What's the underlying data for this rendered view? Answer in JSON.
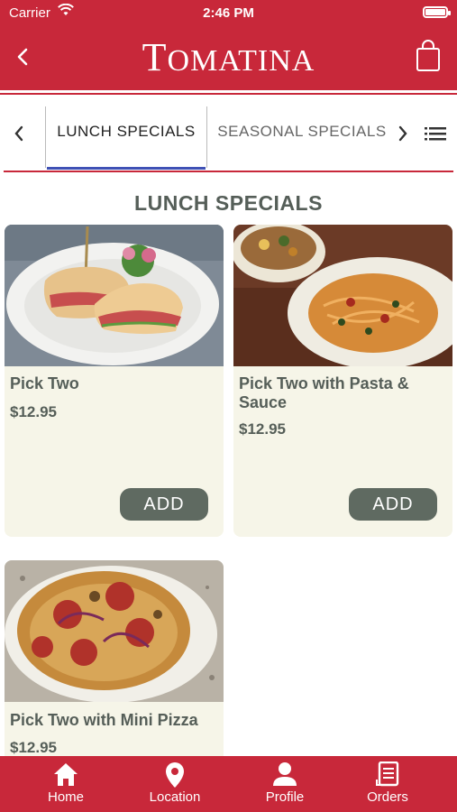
{
  "status_bar": {
    "carrier": "Carrier",
    "time": "2:46 PM"
  },
  "header": {
    "brand_first": "T",
    "brand_rest": "OMATINA",
    "back_icon": "chevron-left-icon",
    "cart_icon": "shopping-bag-icon"
  },
  "categories": {
    "tabs": [
      {
        "label": "LUNCH SPECIALS",
        "active": true
      },
      {
        "label": "SEASONAL SPECIALS",
        "active": false
      }
    ],
    "active_color": "#3f51b5"
  },
  "section": {
    "title": "LUNCH SPECIALS"
  },
  "items": [
    {
      "name": "Pick Two",
      "price": "$12.95",
      "button": "ADD"
    },
    {
      "name": "Pick Two with Pasta & Sauce",
      "price": "$12.95",
      "button": "ADD"
    },
    {
      "name": "Pick Two with Mini Pizza",
      "price": "$12.95"
    }
  ],
  "bottom_nav": [
    {
      "label": "Home",
      "icon": "home-icon"
    },
    {
      "label": "Location",
      "icon": "location-pin-icon"
    },
    {
      "label": "Profile",
      "icon": "profile-icon"
    },
    {
      "label": "Orders",
      "icon": "orders-icon"
    }
  ],
  "colors": {
    "brand_red": "#c8283a",
    "card_bg": "#f6f5e8",
    "button_bg": "#5f6a61",
    "text_dark": "#555e58"
  }
}
